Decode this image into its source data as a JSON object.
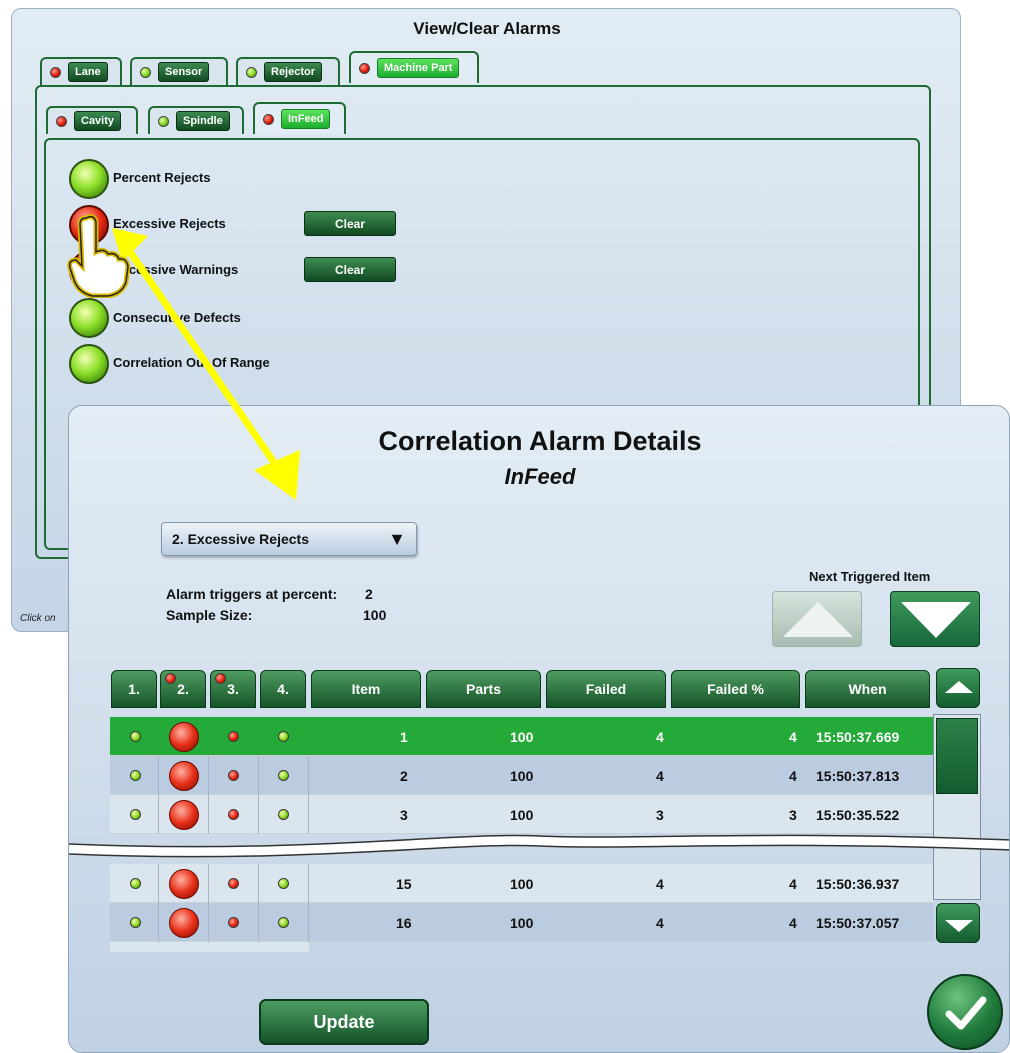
{
  "back_window": {
    "title": "View/Clear Alarms",
    "footer_hint": "Click on",
    "top_tabs": [
      {
        "label": "Lane",
        "status": "red"
      },
      {
        "label": "Sensor",
        "status": "green"
      },
      {
        "label": "Rejector",
        "status": "green"
      },
      {
        "label": "Machine Part",
        "status": "red"
      }
    ],
    "sub_tabs": [
      {
        "label": "Cavity",
        "status": "red"
      },
      {
        "label": "Spindle",
        "status": "green"
      },
      {
        "label": "InFeed",
        "status": "red"
      }
    ],
    "alarms": [
      {
        "label": "Percent Rejects",
        "status": "green",
        "action": ""
      },
      {
        "label": "Excessive Rejects",
        "status": "red",
        "action": "Clear"
      },
      {
        "label": "Excessive Warnings",
        "status": "red",
        "action": "Clear"
      },
      {
        "label": "Consecutive Defects",
        "status": "green",
        "action": ""
      },
      {
        "label": "Correlation Out Of Range",
        "status": "green",
        "action": ""
      }
    ]
  },
  "dialog": {
    "title": "Correlation Alarm Details",
    "subtitle": "InFeed",
    "dropdown_value": "2. Excessive Rejects",
    "dropdown_arrow": "▼",
    "trigger_label": "Alarm triggers at percent:",
    "trigger_value": "2",
    "sample_label": "Sample Size:",
    "sample_value": "100",
    "next_label": "Next Triggered Item",
    "update_label": "Update",
    "columns": [
      "1.",
      "2.",
      "3.",
      "4.",
      "Item",
      "Parts",
      "Failed",
      "Failed %",
      "When"
    ],
    "column_status": [
      "",
      "red",
      "red",
      ""
    ],
    "rows": [
      {
        "item": "1",
        "parts": "100",
        "failed": "4",
        "failed_pct": "4",
        "when": "15:50:37.669"
      },
      {
        "item": "2",
        "parts": "100",
        "failed": "4",
        "failed_pct": "4",
        "when": "15:50:37.813"
      },
      {
        "item": "3",
        "parts": "100",
        "failed": "3",
        "failed_pct": "3",
        "when": "15:50:35.522"
      },
      {
        "item": "15",
        "parts": "100",
        "failed": "4",
        "failed_pct": "4",
        "when": "15:50:36.937"
      },
      {
        "item": "16",
        "parts": "100",
        "failed": "4",
        "failed_pct": "4",
        "when": "15:50:37.057"
      }
    ]
  },
  "colors": {
    "accent_green": "#23aa38",
    "header_green": "#155428",
    "annotation_yellow": "#ffff00"
  },
  "icons": [
    "pointing-hand-cursor",
    "arrow-annotation",
    "triangle-up",
    "triangle-down",
    "checkmark"
  ]
}
